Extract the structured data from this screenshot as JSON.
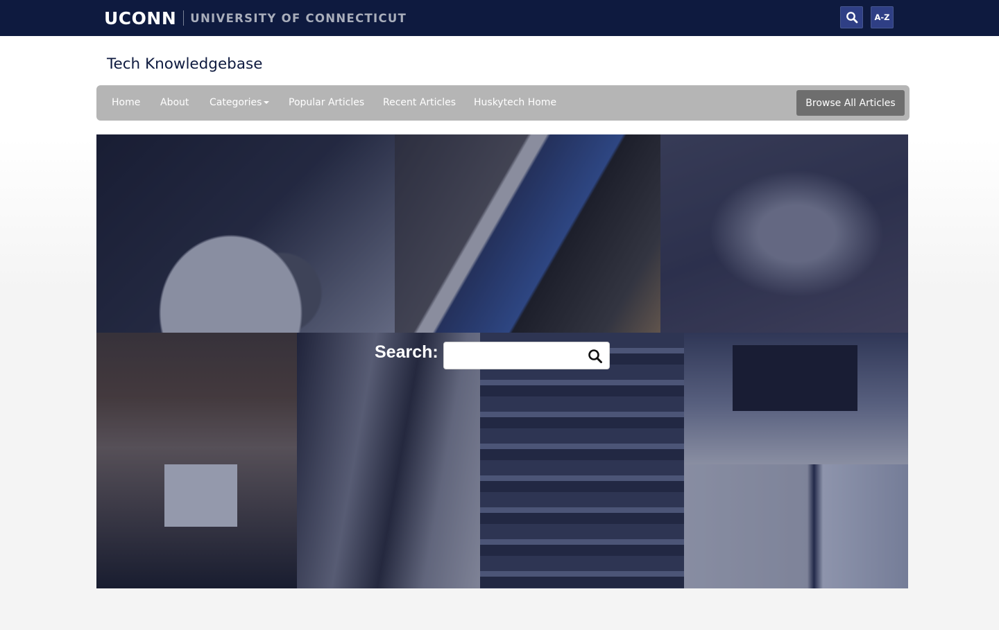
{
  "header": {
    "brand": "UCONN",
    "university": "UNIVERSITY OF CONNECTICUT",
    "search_icon": "search-icon",
    "az_label": "A-Z"
  },
  "site": {
    "title": "Tech Knowledgebase"
  },
  "nav": {
    "items": [
      {
        "label": "Home"
      },
      {
        "label": "About"
      },
      {
        "label": "Categories",
        "has_dropdown": true
      },
      {
        "label": "Popular Articles"
      },
      {
        "label": "Recent Articles"
      },
      {
        "label": "Huskytech Home"
      }
    ],
    "browse_label": "Browse All Articles"
  },
  "hero": {
    "search_label": "Search:",
    "search_placeholder": "",
    "search_icon": "search-icon"
  },
  "colors": {
    "topbar": "#0e1a3f",
    "nav_bg": "#b5b5b5",
    "browse_btn": "#6e6e6e",
    "header_btn": "#2f3f85"
  }
}
